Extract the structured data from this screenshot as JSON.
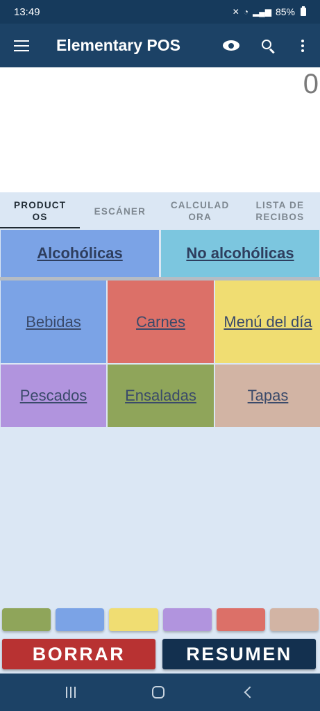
{
  "status": {
    "time": "13:49",
    "battery": "85%"
  },
  "app": {
    "title": "Elementary POS"
  },
  "display": {
    "value": "0"
  },
  "tabs": [
    {
      "label": "PRODUCT\nOS",
      "active": true
    },
    {
      "label": "ESCÁNER",
      "active": false
    },
    {
      "label": "CALCULAD\nORA",
      "active": false
    },
    {
      "label": "LISTA DE\nRECIBOS",
      "active": false
    }
  ],
  "categories": [
    {
      "label": "Alcohólicas",
      "color": "#7ba3e6"
    },
    {
      "label": "No alcohólicas",
      "color": "#7cc6df"
    }
  ],
  "products": [
    {
      "label": "Bebidas",
      "color": "#7ba3e6"
    },
    {
      "label": "Carnes",
      "color": "#dc7068"
    },
    {
      "label": "Menú del día",
      "color": "#f0dd72"
    },
    {
      "label": "Pescados",
      "color": "#b194de"
    },
    {
      "label": "Ensaladas",
      "color": "#8fa55a"
    },
    {
      "label": "Tapas",
      "color": "#d2b4a4"
    }
  ],
  "swatches": [
    "#8fa55a",
    "#7ba3e6",
    "#f0dd72",
    "#b194de",
    "#dc7068",
    "#d2b4a4"
  ],
  "buttons": {
    "clear": {
      "label": "BORRAR",
      "color": "#b83232"
    },
    "summary": {
      "label": "RESUMEN",
      "color": "#13304f"
    }
  },
  "icons": {
    "menu": "hamburger-icon",
    "view": "eye-icon",
    "search": "search-icon",
    "more": "more-vert-icon"
  }
}
